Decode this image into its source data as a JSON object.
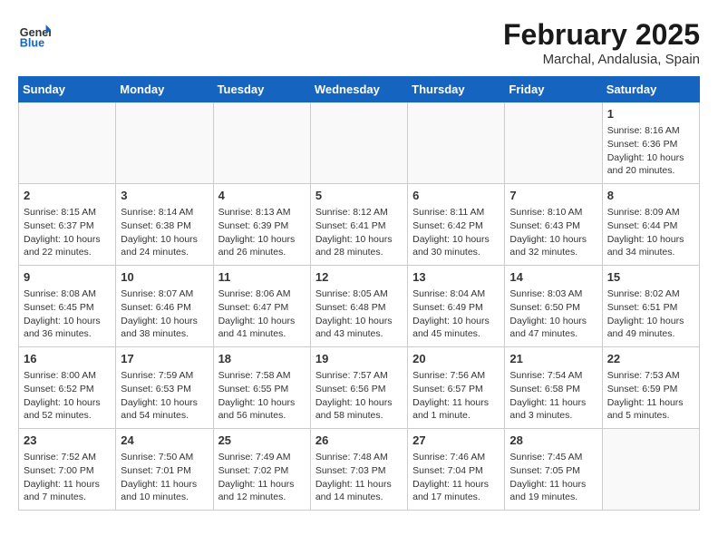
{
  "header": {
    "logo_general": "General",
    "logo_blue": "Blue",
    "month": "February 2025",
    "location": "Marchal, Andalusia, Spain"
  },
  "days_of_week": [
    "Sunday",
    "Monday",
    "Tuesday",
    "Wednesday",
    "Thursday",
    "Friday",
    "Saturday"
  ],
  "weeks": [
    [
      {
        "day": "",
        "info": ""
      },
      {
        "day": "",
        "info": ""
      },
      {
        "day": "",
        "info": ""
      },
      {
        "day": "",
        "info": ""
      },
      {
        "day": "",
        "info": ""
      },
      {
        "day": "",
        "info": ""
      },
      {
        "day": "1",
        "info": "Sunrise: 8:16 AM\nSunset: 6:36 PM\nDaylight: 10 hours and 20 minutes."
      }
    ],
    [
      {
        "day": "2",
        "info": "Sunrise: 8:15 AM\nSunset: 6:37 PM\nDaylight: 10 hours and 22 minutes."
      },
      {
        "day": "3",
        "info": "Sunrise: 8:14 AM\nSunset: 6:38 PM\nDaylight: 10 hours and 24 minutes."
      },
      {
        "day": "4",
        "info": "Sunrise: 8:13 AM\nSunset: 6:39 PM\nDaylight: 10 hours and 26 minutes."
      },
      {
        "day": "5",
        "info": "Sunrise: 8:12 AM\nSunset: 6:41 PM\nDaylight: 10 hours and 28 minutes."
      },
      {
        "day": "6",
        "info": "Sunrise: 8:11 AM\nSunset: 6:42 PM\nDaylight: 10 hours and 30 minutes."
      },
      {
        "day": "7",
        "info": "Sunrise: 8:10 AM\nSunset: 6:43 PM\nDaylight: 10 hours and 32 minutes."
      },
      {
        "day": "8",
        "info": "Sunrise: 8:09 AM\nSunset: 6:44 PM\nDaylight: 10 hours and 34 minutes."
      }
    ],
    [
      {
        "day": "9",
        "info": "Sunrise: 8:08 AM\nSunset: 6:45 PM\nDaylight: 10 hours and 36 minutes."
      },
      {
        "day": "10",
        "info": "Sunrise: 8:07 AM\nSunset: 6:46 PM\nDaylight: 10 hours and 38 minutes."
      },
      {
        "day": "11",
        "info": "Sunrise: 8:06 AM\nSunset: 6:47 PM\nDaylight: 10 hours and 41 minutes."
      },
      {
        "day": "12",
        "info": "Sunrise: 8:05 AM\nSunset: 6:48 PM\nDaylight: 10 hours and 43 minutes."
      },
      {
        "day": "13",
        "info": "Sunrise: 8:04 AM\nSunset: 6:49 PM\nDaylight: 10 hours and 45 minutes."
      },
      {
        "day": "14",
        "info": "Sunrise: 8:03 AM\nSunset: 6:50 PM\nDaylight: 10 hours and 47 minutes."
      },
      {
        "day": "15",
        "info": "Sunrise: 8:02 AM\nSunset: 6:51 PM\nDaylight: 10 hours and 49 minutes."
      }
    ],
    [
      {
        "day": "16",
        "info": "Sunrise: 8:00 AM\nSunset: 6:52 PM\nDaylight: 10 hours and 52 minutes."
      },
      {
        "day": "17",
        "info": "Sunrise: 7:59 AM\nSunset: 6:53 PM\nDaylight: 10 hours and 54 minutes."
      },
      {
        "day": "18",
        "info": "Sunrise: 7:58 AM\nSunset: 6:55 PM\nDaylight: 10 hours and 56 minutes."
      },
      {
        "day": "19",
        "info": "Sunrise: 7:57 AM\nSunset: 6:56 PM\nDaylight: 10 hours and 58 minutes."
      },
      {
        "day": "20",
        "info": "Sunrise: 7:56 AM\nSunset: 6:57 PM\nDaylight: 11 hours and 1 minute."
      },
      {
        "day": "21",
        "info": "Sunrise: 7:54 AM\nSunset: 6:58 PM\nDaylight: 11 hours and 3 minutes."
      },
      {
        "day": "22",
        "info": "Sunrise: 7:53 AM\nSunset: 6:59 PM\nDaylight: 11 hours and 5 minutes."
      }
    ],
    [
      {
        "day": "23",
        "info": "Sunrise: 7:52 AM\nSunset: 7:00 PM\nDaylight: 11 hours and 7 minutes."
      },
      {
        "day": "24",
        "info": "Sunrise: 7:50 AM\nSunset: 7:01 PM\nDaylight: 11 hours and 10 minutes."
      },
      {
        "day": "25",
        "info": "Sunrise: 7:49 AM\nSunset: 7:02 PM\nDaylight: 11 hours and 12 minutes."
      },
      {
        "day": "26",
        "info": "Sunrise: 7:48 AM\nSunset: 7:03 PM\nDaylight: 11 hours and 14 minutes."
      },
      {
        "day": "27",
        "info": "Sunrise: 7:46 AM\nSunset: 7:04 PM\nDaylight: 11 hours and 17 minutes."
      },
      {
        "day": "28",
        "info": "Sunrise: 7:45 AM\nSunset: 7:05 PM\nDaylight: 11 hours and 19 minutes."
      },
      {
        "day": "",
        "info": ""
      }
    ]
  ]
}
